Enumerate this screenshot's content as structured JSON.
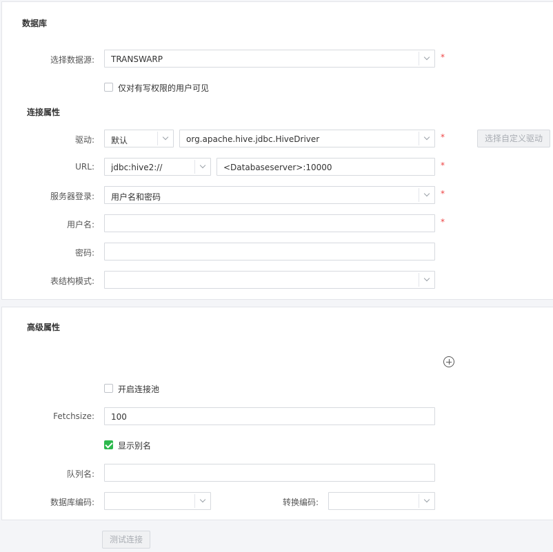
{
  "database_section": {
    "title": "数据库",
    "datasource": {
      "label": "选择数据源:",
      "value": "TRANSWARP"
    },
    "write_permission": {
      "label": "仅对有写权限的用户可见",
      "checked": false
    }
  },
  "connection_section": {
    "title": "连接属性",
    "driver": {
      "label": "驱动:",
      "mode_value": "默认",
      "class_value": "org.apache.hive.jdbc.HiveDriver",
      "custom_button": "选择自定义驱动"
    },
    "url": {
      "label": "URL:",
      "prefix_value": "jdbc:hive2://",
      "host_value": "<Databaseserver>:10000"
    },
    "server_login": {
      "label": "服务器登录:",
      "value": "用户名和密码"
    },
    "username": {
      "label": "用户名:",
      "value": ""
    },
    "password": {
      "label": "密码:",
      "value": ""
    },
    "schema": {
      "label": "表结构模式:",
      "value": ""
    }
  },
  "advanced_section": {
    "title": "高级属性",
    "add_icon": "plus-circle-icon",
    "connection_pool": {
      "label": "开启连接池",
      "checked": false
    },
    "fetchsize": {
      "label": "Fetchsize:",
      "value": "100"
    },
    "show_alias": {
      "label": "显示别名",
      "checked": true
    },
    "queue_name": {
      "label": "队列名:",
      "value": ""
    },
    "db_encoding": {
      "label": "数据库编码:",
      "value": ""
    },
    "convert_encoding": {
      "label": "转换编码:",
      "value": ""
    }
  },
  "footer": {
    "test_button": "测试连接"
  },
  "required_mark": "*",
  "colors": {
    "check_on": "#2db84d",
    "required": "#ee4444"
  }
}
